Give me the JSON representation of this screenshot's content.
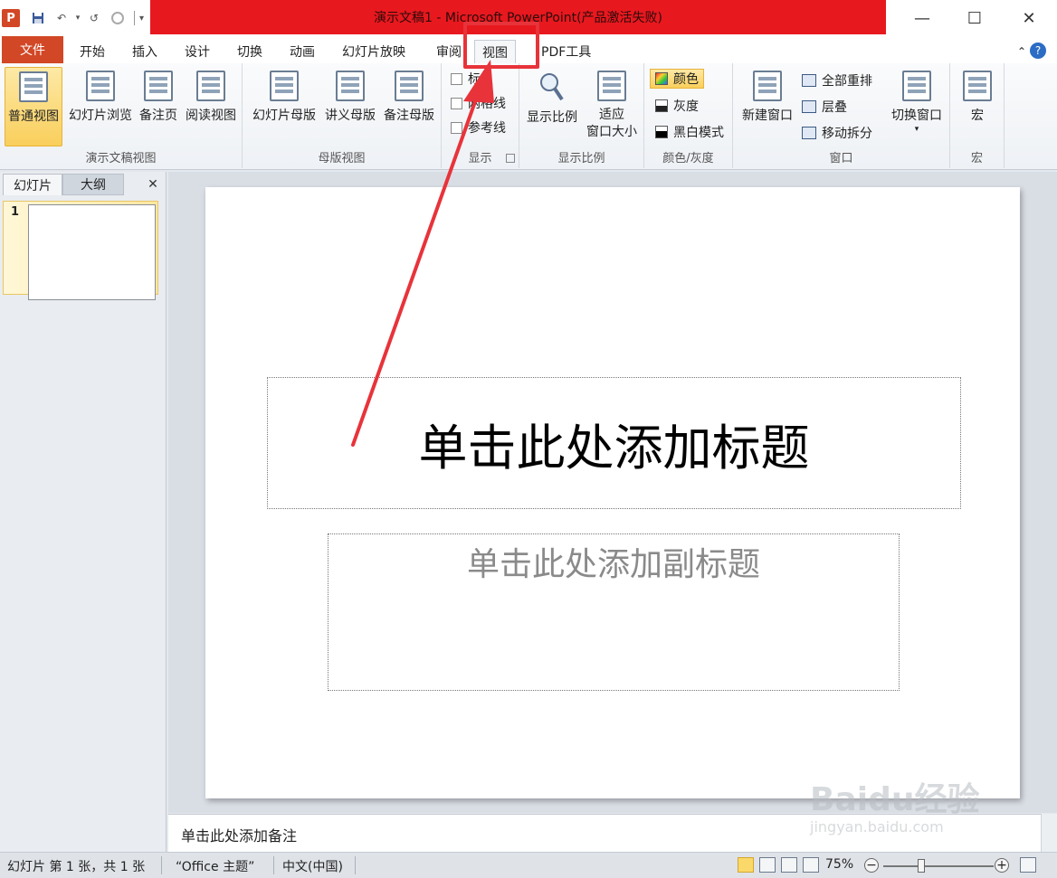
{
  "window": {
    "title": "演示文稿1 - Microsoft PowerPoint(产品激活失败)",
    "minimize": "—",
    "maximize": "☐",
    "close": "✕"
  },
  "qat": {
    "logo": "P",
    "save": "💾",
    "undo": "↶",
    "redo": "↺",
    "more": "▾"
  },
  "tabs": {
    "file": "文件",
    "items": [
      "开始",
      "插入",
      "设计",
      "切换",
      "动画",
      "幻灯片放映",
      "审阅",
      "视图",
      "PDF工具"
    ],
    "help": "?",
    "collapse": "⌃"
  },
  "ribbon": {
    "presentation_views": {
      "label": "演示文稿视图",
      "normal": "普通视图",
      "slide_sorter": "幻灯片浏览",
      "notes_page": "备注页",
      "reading": "阅读视图"
    },
    "master_views": {
      "label": "母版视图",
      "slide_master": "幻灯片母版",
      "handout_master": "讲义母版",
      "notes_master": "备注母版"
    },
    "show": {
      "label": "显示",
      "ruler": "标尺",
      "gridlines": "网格线",
      "guides": "参考线"
    },
    "zoom": {
      "label": "显示比例",
      "zoom": "显示比例",
      "fit_line1": "适应",
      "fit_line2": "窗口大小"
    },
    "color": {
      "label": "颜色/灰度",
      "color": "颜色",
      "grayscale": "灰度",
      "bw": "黑白模式"
    },
    "window": {
      "label": "窗口",
      "new_window": "新建窗口",
      "arrange_all": "全部重排",
      "cascade": "层叠",
      "move_split": "移动拆分",
      "switch_window": "切换窗口"
    },
    "macros": {
      "label": "宏",
      "macros": "宏"
    }
  },
  "left_pane": {
    "tab_slides": "幻灯片",
    "tab_outline": "大纲",
    "close": "✕",
    "slide_number": "1"
  },
  "slide": {
    "title_placeholder": "单击此处添加标题",
    "subtitle_placeholder": "单击此处添加副标题"
  },
  "notes": {
    "placeholder": "单击此处添加备注"
  },
  "status": {
    "slide_info": "幻灯片 第 1 张，共 1 张",
    "theme": "“Office 主题”",
    "language": "中文(中国)",
    "zoom": "75%",
    "zoom_out": "−",
    "zoom_in": "+"
  },
  "watermark": {
    "text": "Baidu经验",
    "sub": "jingyan.baidu.com"
  },
  "colors": {
    "accent": "#d24726",
    "title_bar": "#e8181f",
    "annotation": "#e8333a"
  }
}
